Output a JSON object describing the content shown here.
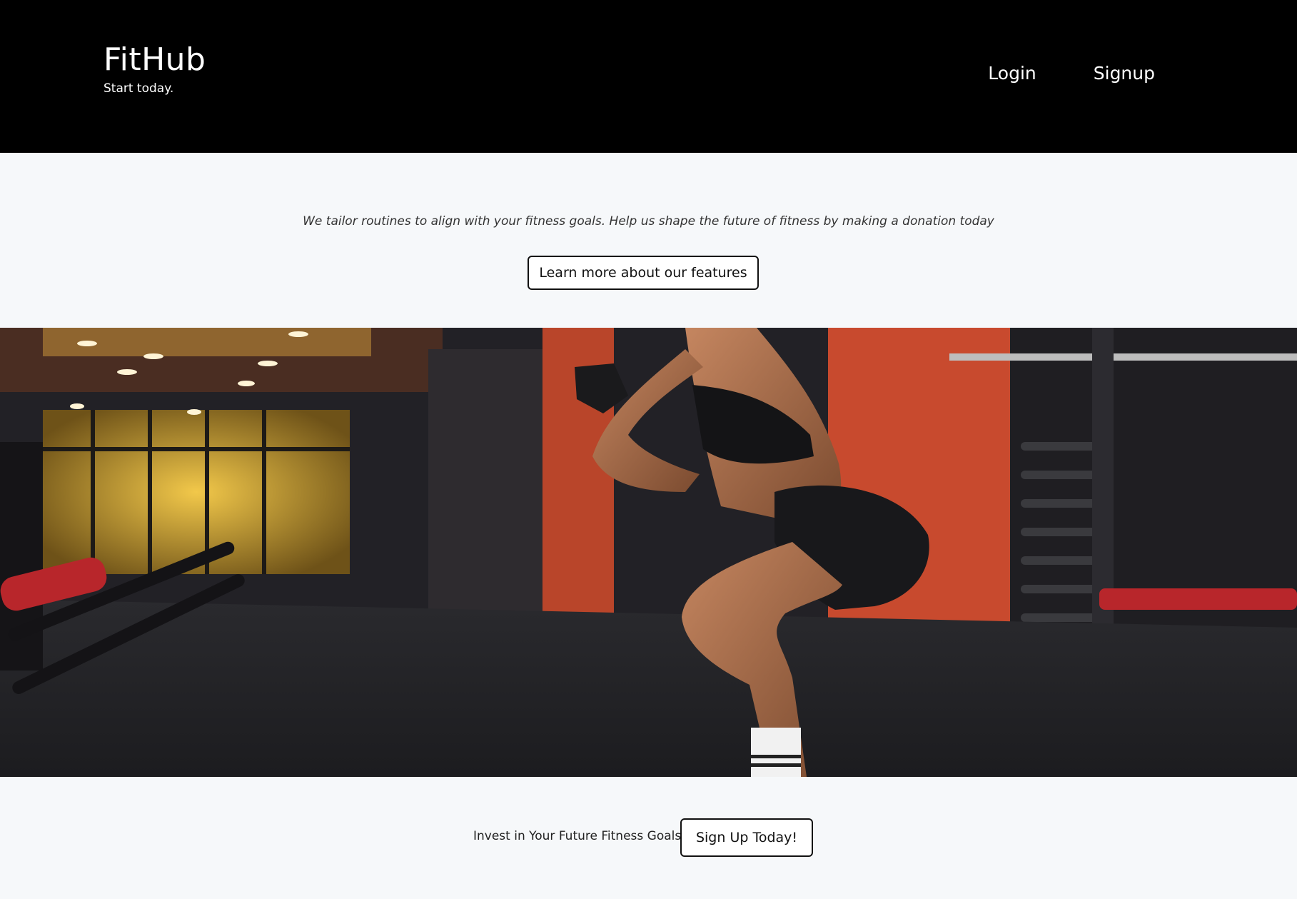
{
  "header": {
    "brand_title": "FitHub",
    "brand_tagline": "Start today.",
    "nav": {
      "login_label": "Login",
      "signup_label": "Signup"
    }
  },
  "intro": {
    "text": "We tailor routines to align with your fitness goals. Help us shape the future of fitness by making a donation today",
    "features_button_label": "Learn more about our features"
  },
  "hero": {
    "image_subject": "woman-squatting-in-gym"
  },
  "cta": {
    "text": "Invest in Your Future Fitness Goals",
    "button_label": "Sign Up Today!"
  },
  "colors": {
    "header_bg": "#000000",
    "page_bg": "#f6f8fa",
    "accent_red": "#c84a2e"
  }
}
